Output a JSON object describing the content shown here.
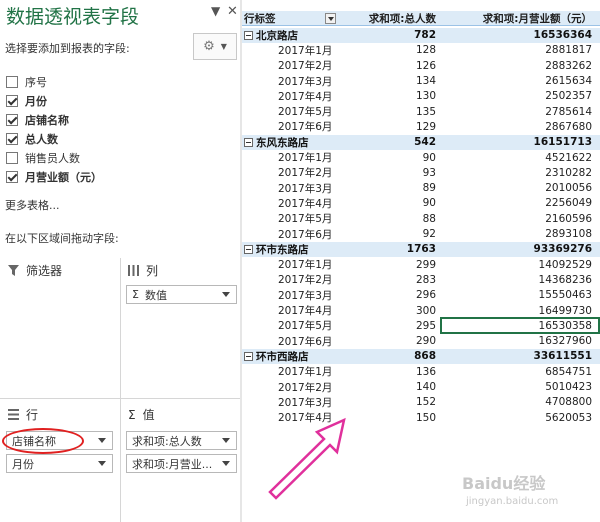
{
  "pane": {
    "title": "数据透视表字段",
    "subtitle": "选择要添加到报表的字段:",
    "fields": [
      {
        "label": "序号",
        "checked": false
      },
      {
        "label": "月份",
        "checked": true
      },
      {
        "label": "店铺名称",
        "checked": true
      },
      {
        "label": "总人数",
        "checked": true
      },
      {
        "label": "销售员人数",
        "checked": false
      },
      {
        "label": "月营业额（元）",
        "checked": true
      }
    ],
    "more_tables": "更多表格...",
    "drag_hint": "在以下区域间拖动字段:",
    "areas": {
      "filters": "筛选器",
      "columns": "列",
      "rows": "行",
      "values": "值",
      "columns_items": [
        "数值"
      ],
      "rows_items": [
        "店铺名称",
        "月份"
      ],
      "values_items": [
        "求和项:总人数",
        "求和项:月营业..."
      ]
    }
  },
  "pivot": {
    "headers": [
      "行标签",
      "求和项:总人数",
      "求和项:月营业额（元）"
    ],
    "rows": [
      {
        "type": "store",
        "label": "北京路店",
        "people": "782",
        "revenue": "16536364"
      },
      {
        "type": "month",
        "label": "2017年1月",
        "people": "128",
        "revenue": "2881817"
      },
      {
        "type": "month",
        "label": "2017年2月",
        "people": "126",
        "revenue": "2883262"
      },
      {
        "type": "month",
        "label": "2017年3月",
        "people": "134",
        "revenue": "2615634"
      },
      {
        "type": "month",
        "label": "2017年4月",
        "people": "130",
        "revenue": "2502357"
      },
      {
        "type": "month",
        "label": "2017年5月",
        "people": "135",
        "revenue": "2785614"
      },
      {
        "type": "month",
        "label": "2017年6月",
        "people": "129",
        "revenue": "2867680"
      },
      {
        "type": "store",
        "label": "东风东路店",
        "people": "542",
        "revenue": "16151713"
      },
      {
        "type": "month",
        "label": "2017年1月",
        "people": "90",
        "revenue": "4521622"
      },
      {
        "type": "month",
        "label": "2017年2月",
        "people": "93",
        "revenue": "2310282"
      },
      {
        "type": "month",
        "label": "2017年3月",
        "people": "89",
        "revenue": "2010056"
      },
      {
        "type": "month",
        "label": "2017年4月",
        "people": "90",
        "revenue": "2256049"
      },
      {
        "type": "month",
        "label": "2017年5月",
        "people": "88",
        "revenue": "2160596"
      },
      {
        "type": "month",
        "label": "2017年6月",
        "people": "92",
        "revenue": "2893108"
      },
      {
        "type": "store",
        "label": "环市东路店",
        "people": "1763",
        "revenue": "93369276"
      },
      {
        "type": "month",
        "label": "2017年1月",
        "people": "299",
        "revenue": "14092529"
      },
      {
        "type": "month",
        "label": "2017年2月",
        "people": "283",
        "revenue": "14368236"
      },
      {
        "type": "month",
        "label": "2017年3月",
        "people": "296",
        "revenue": "15550463"
      },
      {
        "type": "month",
        "label": "2017年4月",
        "people": "300",
        "revenue": "16499730"
      },
      {
        "type": "month",
        "label": "2017年5月",
        "people": "295",
        "revenue": "16530358"
      },
      {
        "type": "month",
        "label": "2017年6月",
        "people": "290",
        "revenue": "16327960"
      },
      {
        "type": "store",
        "label": "环市西路店",
        "people": "868",
        "revenue": "33611551"
      },
      {
        "type": "month",
        "label": "2017年1月",
        "people": "136",
        "revenue": "6854751"
      },
      {
        "type": "month",
        "label": "2017年2月",
        "people": "140",
        "revenue": "5010423"
      },
      {
        "type": "month",
        "label": "2017年3月",
        "people": "152",
        "revenue": "4708800"
      },
      {
        "type": "month",
        "label": "2017年4月",
        "people": "150",
        "revenue": "5620053"
      }
    ]
  },
  "watermark": {
    "text": "Baidu经验",
    "url": "jingyan.baidu.com"
  },
  "colors": {
    "accent": "#217346",
    "header_fill": "#ddebf7",
    "annotation_red": "#e02020",
    "arrow_magenta": "#e0309c"
  }
}
